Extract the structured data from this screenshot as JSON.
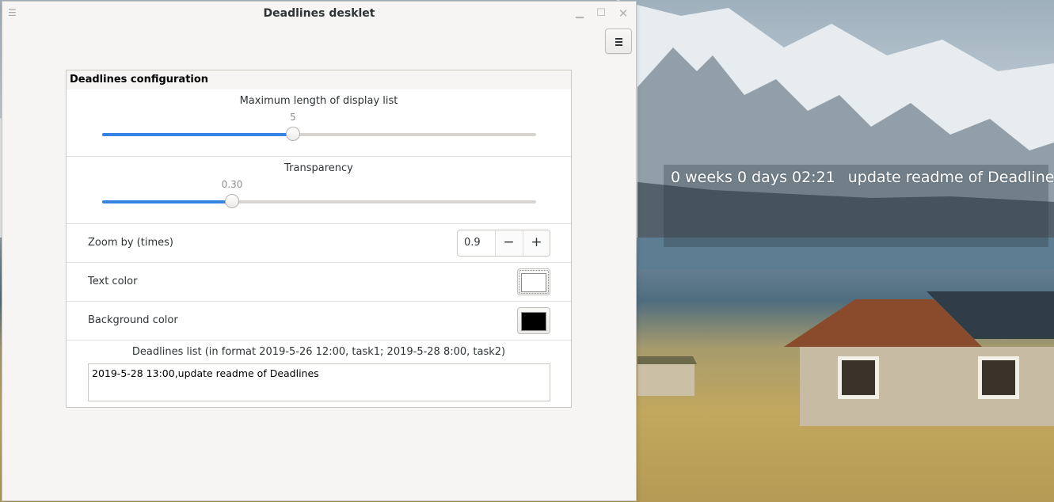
{
  "window": {
    "title": "Deadlines desklet"
  },
  "config": {
    "frame_title": "Deadlines configuration",
    "max_length": {
      "label": "Maximum length of display list",
      "value": "5",
      "fraction": 0.44
    },
    "transparency": {
      "label": "Transparency",
      "value": "0.30",
      "fraction": 0.3
    },
    "zoom": {
      "label": "Zoom by (times)",
      "value": "0.9",
      "minus": "−",
      "plus": "+"
    },
    "text_color": {
      "label": "Text color",
      "color": "#ffffff"
    },
    "background_color": {
      "label": "Background color",
      "color": "#000000"
    },
    "deadlines": {
      "label": "Deadlines list (in format 2019-5-26 12:00, task1; 2019-5-28 8:00, task2)",
      "value": "2019-5-28 13:00,update readme of Deadlines"
    }
  },
  "desklet": {
    "countdown": "0 weeks 0 days 02:21",
    "task": "update readme of Deadlines"
  },
  "colors": {
    "accent": "#3584e4",
    "window_bg": "#f6f5f4"
  },
  "icons": [
    "window-menu-icon",
    "minimize-icon",
    "maximize-icon",
    "close-icon",
    "hamburger-menu-icon",
    "minus-icon",
    "plus-icon"
  ]
}
